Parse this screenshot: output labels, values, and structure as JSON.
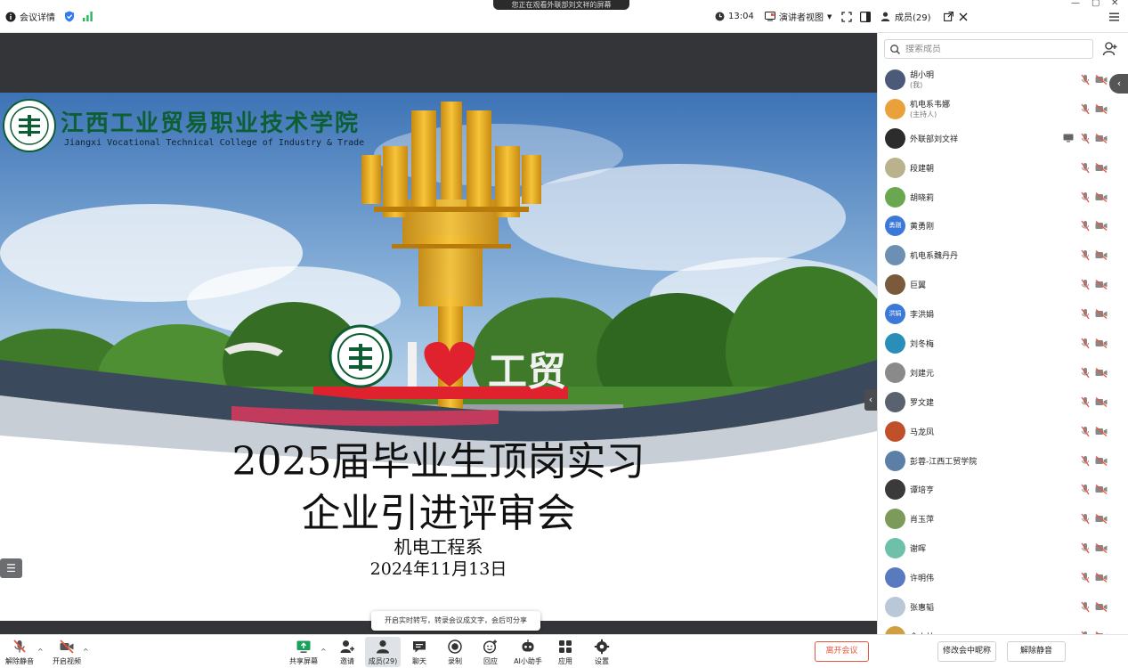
{
  "colors": {
    "accent": "#2f7cf6",
    "end_meeting": "#e8563f",
    "school_green": "#0d5e33",
    "stage_bg": "#333538",
    "heart_red": "#e0212e",
    "signal_green": "#2bb55b"
  },
  "topbar": {
    "info_label": "会议详情",
    "sharing_banner": "您正在观看外联部刘文祥的屏幕",
    "time": "13:04",
    "view_label": "演讲者视图",
    "members_label": "成员(29)"
  },
  "slide": {
    "school_cn": "江西工业贸易职业技术学院",
    "school_en": "Jiangxi  Vocational Technical College of Industry & Trade",
    "heart_caption_left": "I",
    "heart_caption_right": "工贸",
    "title_line1": "2025届毕业生顶岗实习",
    "title_line2": "企业引进评审会",
    "department": "机电工程系",
    "date": "2024年11月13日"
  },
  "panel": {
    "search_placeholder": "搜索成员",
    "members": [
      {
        "name": "胡小明",
        "role": "(我)",
        "avatar_color": "#4a5a78",
        "avatar_text": ""
      },
      {
        "name": "机电系韦娜",
        "role": "(主持人)",
        "avatar_color": "#e9a23b",
        "avatar_text": ""
      },
      {
        "name": "外联部刘文祥",
        "role": "",
        "avatar_color": "#2c2c2c",
        "avatar_text": ""
      },
      {
        "name": "段建朝",
        "role": "",
        "avatar_color": "#b9b28c",
        "avatar_text": ""
      },
      {
        "name": "胡晓莉",
        "role": "",
        "avatar_color": "#6aa84f",
        "avatar_text": ""
      },
      {
        "name": "黄勇刚",
        "role": "",
        "avatar_color": "#3b78d8",
        "avatar_text": "勇刚"
      },
      {
        "name": "机电系魏丹丹",
        "role": "",
        "avatar_color": "#6d8fb3",
        "avatar_text": ""
      },
      {
        "name": "巨翼",
        "role": "",
        "avatar_color": "#7a5a3a",
        "avatar_text": ""
      },
      {
        "name": "李洪娟",
        "role": "",
        "avatar_color": "#3b78d8",
        "avatar_text": "洪娟"
      },
      {
        "name": "刘冬梅",
        "role": "",
        "avatar_color": "#2a8fb8",
        "avatar_text": ""
      },
      {
        "name": "刘建元",
        "role": "",
        "avatar_color": "#8a8a8a",
        "avatar_text": ""
      },
      {
        "name": "罗文建",
        "role": "",
        "avatar_color": "#5a6270",
        "avatar_text": ""
      },
      {
        "name": "马龙凤",
        "role": "",
        "avatar_color": "#c0502a",
        "avatar_text": ""
      },
      {
        "name": "彭蓉-江西工贸学院",
        "role": "",
        "avatar_color": "#5c7fa8",
        "avatar_text": ""
      },
      {
        "name": "谭培亨",
        "role": "",
        "avatar_color": "#3a3a3a",
        "avatar_text": ""
      },
      {
        "name": "肖玉萍",
        "role": "",
        "avatar_color": "#7c9a5a",
        "avatar_text": ""
      },
      {
        "name": "谢晖",
        "role": "",
        "avatar_color": "#6fc0a8",
        "avatar_text": ""
      },
      {
        "name": "许明伟",
        "role": "",
        "avatar_color": "#5a7ac0",
        "avatar_text": ""
      },
      {
        "name": "张惠韬",
        "role": "",
        "avatar_color": "#b8c8d8",
        "avatar_text": ""
      },
      {
        "name": "余小林",
        "role": "",
        "avatar_color": "#d0a040",
        "avatar_text": ""
      }
    ]
  },
  "toolbar": {
    "unmute": "解除静音",
    "start_video": "开启视频",
    "share_screen": "共享屏幕",
    "invite": "邀请",
    "members": "成员(29)",
    "chat": "聊天",
    "record": "录制",
    "reactions": "回应",
    "ai_assistant": "AI小助手",
    "apps": "应用",
    "settings": "设置",
    "leave": "离开会议",
    "rename": "修改会中昵称",
    "unmute_right": "解除静音",
    "tooltip": "开启实时转写，转录会议成文字，会后可分享"
  }
}
